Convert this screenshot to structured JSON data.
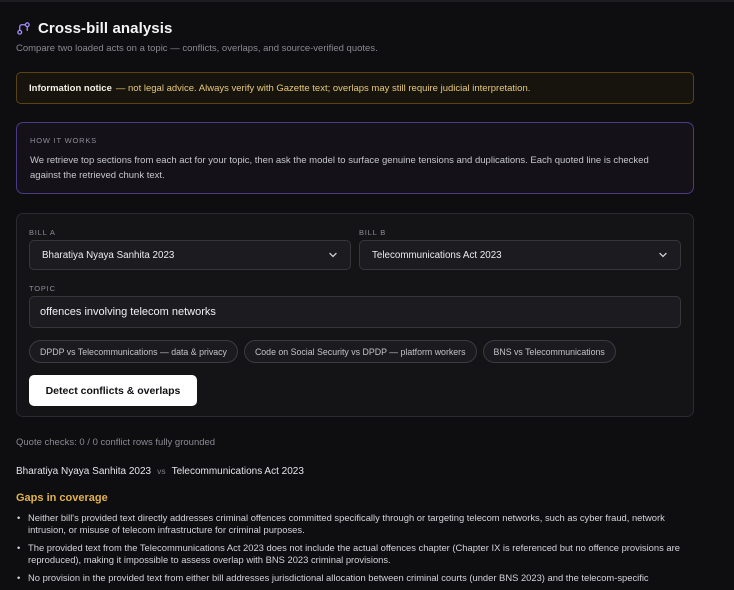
{
  "header": {
    "title": "Cross-bill analysis",
    "subtitle": "Compare two loaded acts on a topic — conflicts, overlaps, and source-verified quotes.",
    "icon": "git-compare-icon",
    "accent_color": "#a78bfa"
  },
  "notice": {
    "label": "Information notice",
    "text": "— not legal advice. Always verify with Gazette text; overlaps may still require judicial interpretation."
  },
  "how_it_works": {
    "label": "HOW IT WORKS",
    "text": "We retrieve top sections from each act for your topic, then ask the model to surface genuine tensions and duplications. Each quoted line is checked against the retrieved chunk text."
  },
  "form": {
    "bill_a_label": "BILL A",
    "bill_a_value": "Bharatiya Nyaya Sanhita 2023",
    "bill_b_label": "BILL B",
    "bill_b_value": "Telecommunications Act 2023",
    "topic_label": "TOPIC",
    "topic_value": "offences involving telecom networks",
    "suggestions": [
      "DPDP vs Telecommunications — data & privacy",
      "Code on Social Security vs DPDP — platform workers",
      "BNS vs Telecommunications"
    ],
    "detect_label": "Detect conflicts & overlaps"
  },
  "results": {
    "quote_checks": "Quote checks: 0 / 0 conflict rows fully grounded",
    "bill_a": "Bharatiya Nyaya Sanhita 2023",
    "vs": "vs",
    "bill_b": "Telecommunications Act 2023",
    "gaps_title": "Gaps in coverage",
    "gaps": [
      "Neither bill's provided text directly addresses criminal offences committed specifically through or targeting telecom networks, such as cyber fraud, network intrusion, or misuse of telecom infrastructure for criminal purposes.",
      "The provided text from the Telecommunications Act 2023 does not include the actual offences chapter (Chapter IX is referenced but no offence provisions are reproduced), making it impossible to assess overlap with BNS 2023 criminal provisions.",
      "No provision in the provided text from either bill addresses jurisdictional allocation between criminal courts (under BNS 2023) and the telecom-specific"
    ]
  }
}
